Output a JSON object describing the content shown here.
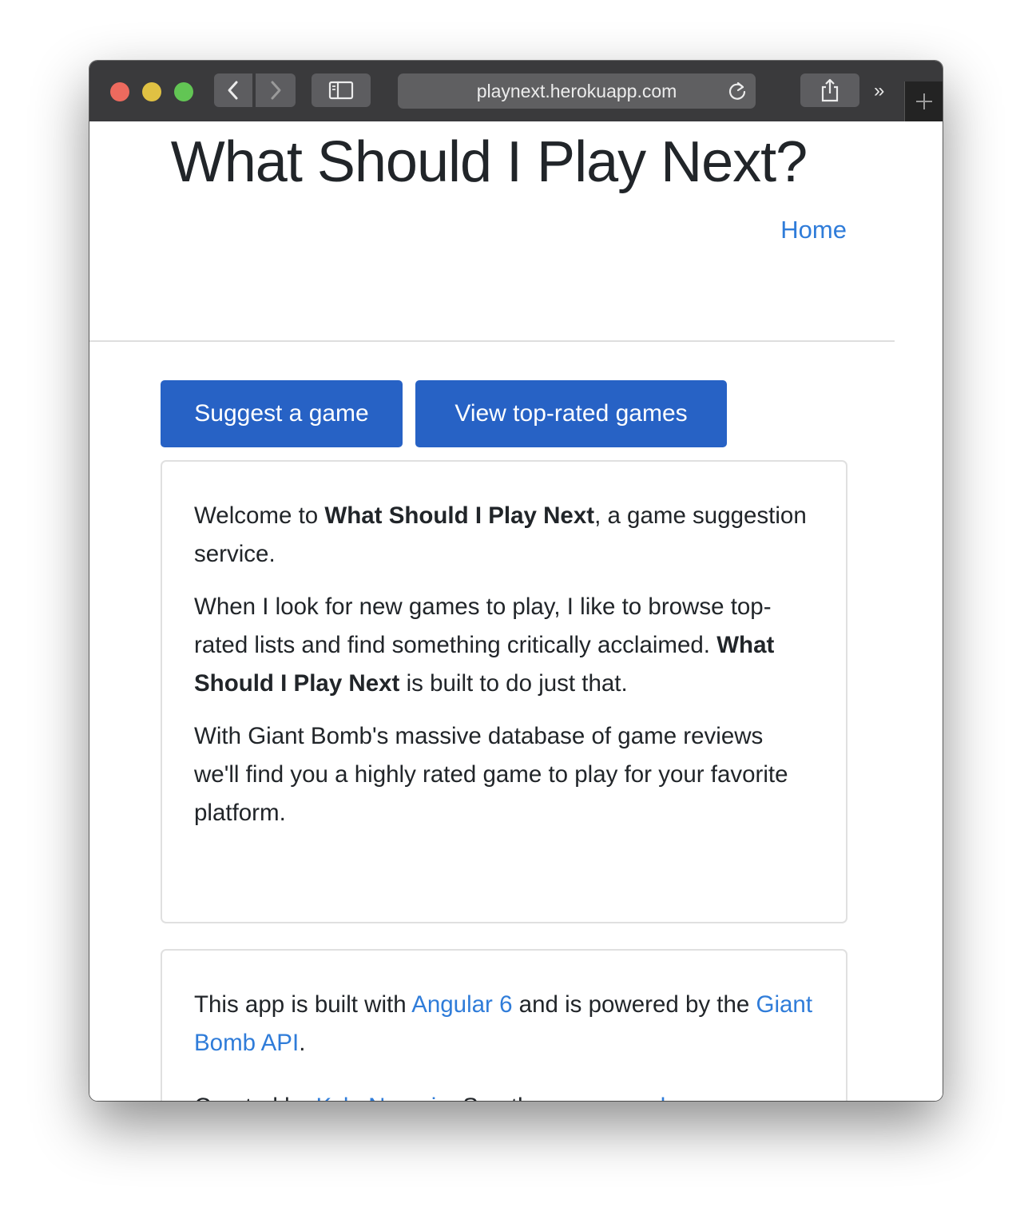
{
  "browser": {
    "url": "playnext.herokuapp.com"
  },
  "header": {
    "title": "What Should I Play Next?",
    "home_link": "Home"
  },
  "actions": {
    "suggest": "Suggest a game",
    "top_rated": "View top-rated games"
  },
  "intro": {
    "p1_pre": "Welcome to ",
    "p1_bold": "What Should I Play Next",
    "p1_post": ", a game suggestion service.",
    "p2_pre": "When I look for new games to play, I like to browse top-rated lists and find something critically acclaimed. ",
    "p2_bold": "What Should I Play Next",
    "p2_post": " is built to do just that.",
    "p3": "With Giant Bomb's massive database of game reviews we'll find you a highly rated game to play for your favorite platform."
  },
  "about": {
    "p1_pre": "This app is built with ",
    "p1_link1": "Angular 6",
    "p1_mid": " and is powered by the ",
    "p1_link2": "Giant Bomb API",
    "p1_post": ".",
    "p2_pre": "Created by ",
    "p2_link1": "Kyle Nazario",
    "p2_mid": ". See the ",
    "p2_link2": "source code",
    "p2_post": "."
  }
}
